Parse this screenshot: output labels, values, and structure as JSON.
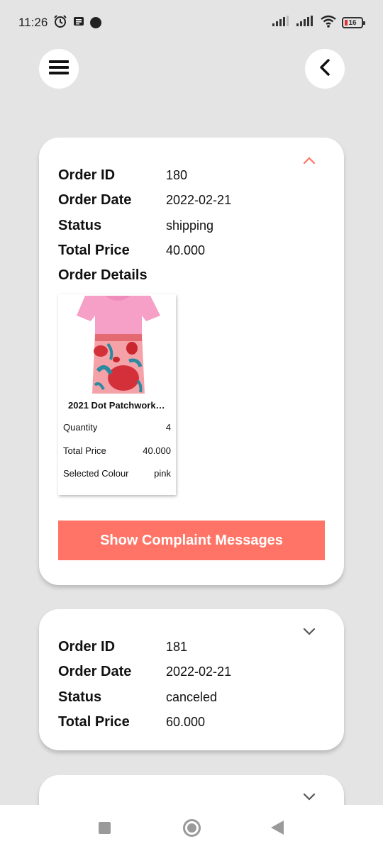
{
  "status_bar": {
    "time": "11:26",
    "battery": "16",
    "icons": [
      "alarm-icon",
      "notification-icon",
      "dot-icon",
      "signal-icon",
      "signal-icon",
      "wifi-icon",
      "battery-icon"
    ]
  },
  "header": {
    "menu_icon": "hamburger-icon",
    "back_icon": "chevron-left-icon"
  },
  "colors": {
    "accent": "#ff7466",
    "background": "#e4e4e4",
    "card": "#ffffff"
  },
  "orders": [
    {
      "expanded": true,
      "labels": {
        "id": "Order ID",
        "date": "Order Date",
        "status": "Status",
        "total": "Total Price",
        "details": "Order Details"
      },
      "id": "180",
      "date": "2022-02-21",
      "status": "shipping",
      "total": "40.000",
      "items": [
        {
          "name": "2021 Dot Patchwork…",
          "quantity_label": "Quantity",
          "quantity": "4",
          "total_label": "Total Price",
          "total": "40.000",
          "colour_label": "Selected Colour",
          "colour": "pink"
        }
      ],
      "complaint_button": "Show Complaint Messages"
    },
    {
      "expanded": false,
      "labels": {
        "id": "Order ID",
        "date": "Order Date",
        "status": "Status",
        "total": "Total Price"
      },
      "id": "181",
      "date": "2022-02-21",
      "status": "canceled",
      "total": "60.000"
    },
    {
      "expanded": false
    }
  ],
  "nav_bar": {
    "icons": [
      "recents-square-icon",
      "home-circle-icon",
      "back-triangle-icon"
    ]
  }
}
